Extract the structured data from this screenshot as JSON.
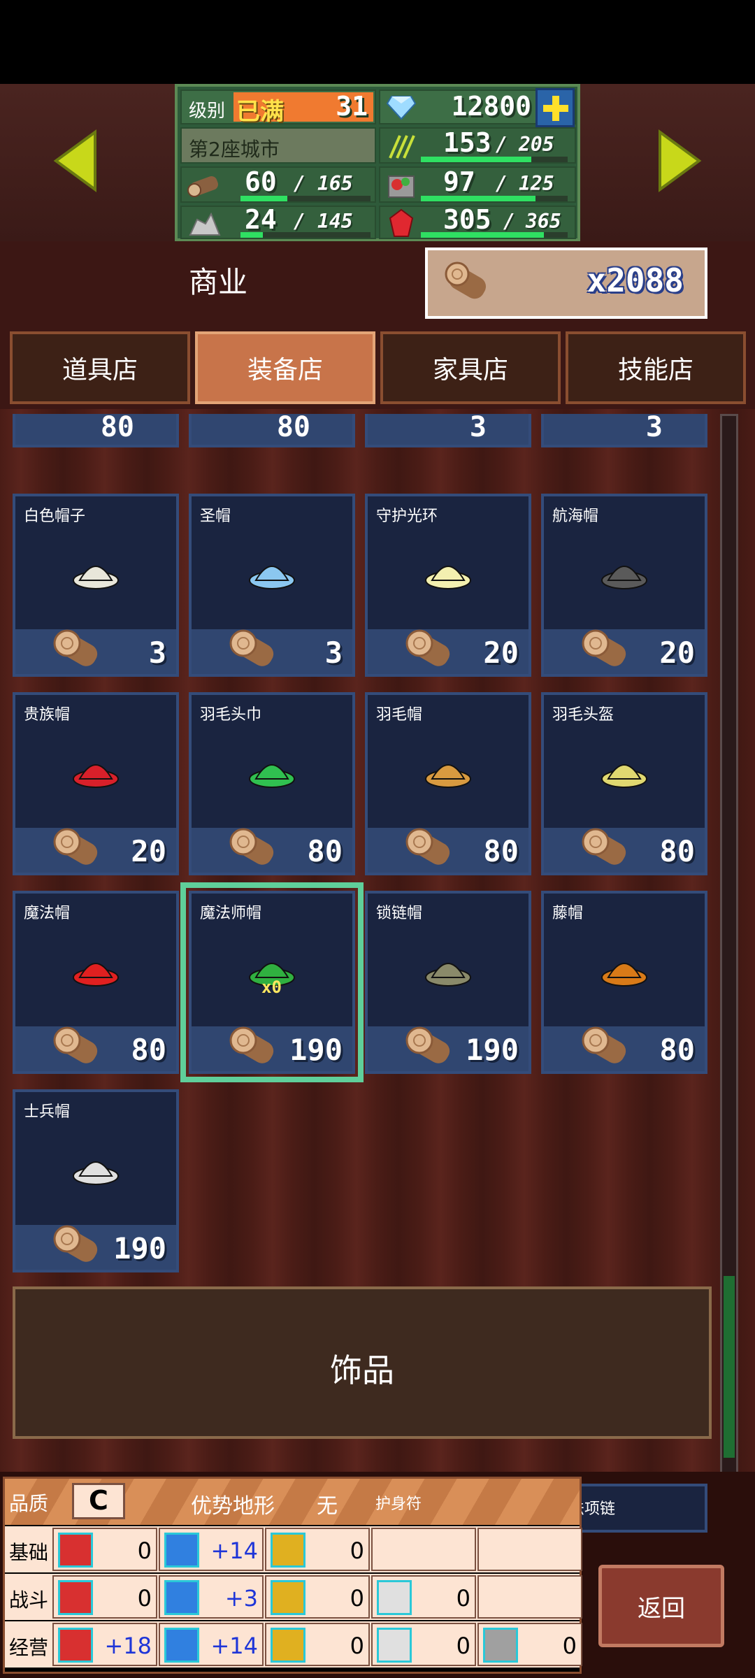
{
  "header": {
    "level_label": "级别",
    "level_badge": "已满",
    "level_value": "31",
    "gems": "12800",
    "city_name": "第2座城市",
    "resources": {
      "crop": {
        "current": "153",
        "max": "205",
        "fill": 0.75
      },
      "wood": {
        "current": "60",
        "max": "165",
        "fill": 0.36
      },
      "food": {
        "current": "97",
        "max": "125",
        "fill": 0.78
      },
      "stone": {
        "current": "24",
        "max": "145",
        "fill": 0.17
      },
      "ruby": {
        "current": "305",
        "max": "365",
        "fill": 0.84
      }
    },
    "slash": "/"
  },
  "commerce": {
    "label": "商业",
    "wood_count": "x2088"
  },
  "tabs": [
    {
      "label": "道具店",
      "active": false
    },
    {
      "label": "装备店",
      "active": true
    },
    {
      "label": "家具店",
      "active": false
    },
    {
      "label": "技能店",
      "active": false
    }
  ],
  "partial_row": [
    "80",
    "80",
    "3",
    "3"
  ],
  "items": [
    {
      "name": "白色帽子",
      "price": "3",
      "color": "#e8e6da"
    },
    {
      "name": "圣帽",
      "price": "3",
      "color": "#8bc7f0"
    },
    {
      "name": "守护光环",
      "price": "20",
      "color": "#f3f0b0"
    },
    {
      "name": "航海帽",
      "price": "20",
      "color": "#5a5a5a"
    },
    {
      "name": "贵族帽",
      "price": "20",
      "color": "#d8202a"
    },
    {
      "name": "羽毛头巾",
      "price": "80",
      "color": "#30c050"
    },
    {
      "name": "羽毛帽",
      "price": "80",
      "color": "#d89a40"
    },
    {
      "name": "羽毛头盔",
      "price": "80",
      "color": "#e0d870"
    },
    {
      "name": "魔法帽",
      "price": "80",
      "color": "#e02020"
    },
    {
      "name": "魔法师帽",
      "price": "190",
      "color": "#30b040",
      "owned": "x0"
    },
    {
      "name": "锁链帽",
      "price": "190",
      "color": "#8a8a6a"
    },
    {
      "name": "藤帽",
      "price": "80",
      "color": "#d87a18"
    },
    {
      "name": "士兵帽",
      "price": "190",
      "color": "#e0e0e0"
    }
  ],
  "section": {
    "title": "饰品"
  },
  "peek_item": {
    "name": "魔法项链"
  },
  "info_panel": {
    "head": {
      "quality_label": "品质",
      "grade": "C",
      "advantage_label": "优势地形",
      "advantage_value": "无",
      "amulet_label": "护身符"
    },
    "rows": [
      {
        "label": "基础",
        "cells": [
          {
            "value": "0",
            "plus": false
          },
          {
            "value": "+14",
            "plus": true
          },
          {
            "value": "0",
            "plus": false
          }
        ]
      },
      {
        "label": "战斗",
        "cells": [
          {
            "value": "0",
            "plus": false
          },
          {
            "value": "+3",
            "plus": true
          },
          {
            "value": "0",
            "plus": false
          },
          {
            "value": "0",
            "plus": false
          }
        ]
      },
      {
        "label": "经营",
        "cells": [
          {
            "value": "+18",
            "plus": true
          },
          {
            "value": "+14",
            "plus": true
          },
          {
            "value": "0",
            "plus": false
          },
          {
            "value": "0",
            "plus": false
          },
          {
            "value": "0",
            "plus": false
          }
        ]
      }
    ]
  },
  "return_button": "返回"
}
